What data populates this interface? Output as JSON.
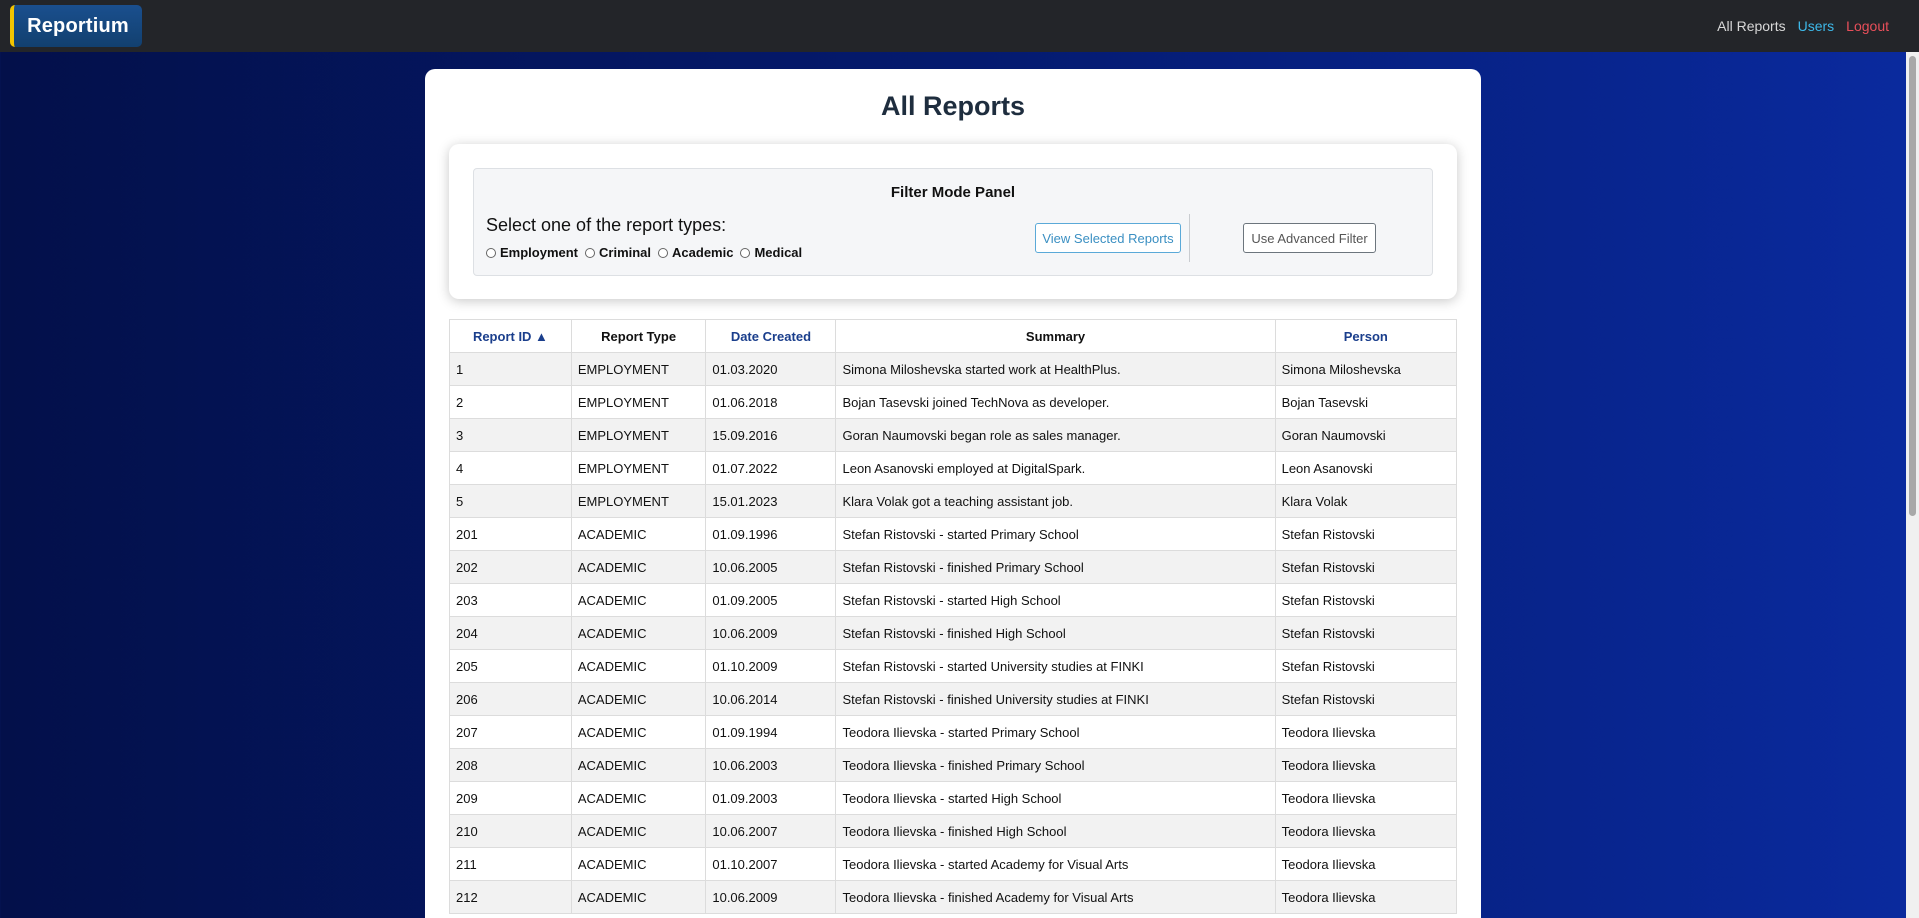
{
  "nav": {
    "brand": "Reportium",
    "links": {
      "all_reports": "All Reports",
      "users": "Users",
      "logout": "Logout"
    }
  },
  "page": {
    "title": "All Reports"
  },
  "filter": {
    "title": "Filter Mode Panel",
    "question": "Select one of the report types:",
    "options": [
      "Employment",
      "Criminal",
      "Academic",
      "Medical"
    ],
    "view_button": "View Selected Reports",
    "advanced_button": "Use Advanced Filter"
  },
  "table": {
    "headers": {
      "id": "Report ID ▲",
      "type": "Report Type",
      "date": "Date Created",
      "summary": "Summary",
      "person": "Person"
    },
    "rows": [
      {
        "id": "1",
        "type": "EMPLOYMENT",
        "date": "01.03.2020",
        "summary": "Simona Miloshevska started work at HealthPlus.",
        "person": "Simona Miloshevska"
      },
      {
        "id": "2",
        "type": "EMPLOYMENT",
        "date": "01.06.2018",
        "summary": "Bojan Tasevski joined TechNova as developer.",
        "person": "Bojan Tasevski"
      },
      {
        "id": "3",
        "type": "EMPLOYMENT",
        "date": "15.09.2016",
        "summary": "Goran Naumovski began role as sales manager.",
        "person": "Goran Naumovski"
      },
      {
        "id": "4",
        "type": "EMPLOYMENT",
        "date": "01.07.2022",
        "summary": "Leon Asanovski employed at DigitalSpark.",
        "person": "Leon Asanovski"
      },
      {
        "id": "5",
        "type": "EMPLOYMENT",
        "date": "15.01.2023",
        "summary": "Klara Volak got a teaching assistant job.",
        "person": "Klara Volak"
      },
      {
        "id": "201",
        "type": "ACADEMIC",
        "date": "01.09.1996",
        "summary": "Stefan Ristovski - started Primary School",
        "person": "Stefan Ristovski"
      },
      {
        "id": "202",
        "type": "ACADEMIC",
        "date": "10.06.2005",
        "summary": "Stefan Ristovski - finished Primary School",
        "person": "Stefan Ristovski"
      },
      {
        "id": "203",
        "type": "ACADEMIC",
        "date": "01.09.2005",
        "summary": "Stefan Ristovski - started High School",
        "person": "Stefan Ristovski"
      },
      {
        "id": "204",
        "type": "ACADEMIC",
        "date": "10.06.2009",
        "summary": "Stefan Ristovski - finished High School",
        "person": "Stefan Ristovski"
      },
      {
        "id": "205",
        "type": "ACADEMIC",
        "date": "01.10.2009",
        "summary": "Stefan Ristovski - started University studies at FINKI",
        "person": "Stefan Ristovski"
      },
      {
        "id": "206",
        "type": "ACADEMIC",
        "date": "10.06.2014",
        "summary": "Stefan Ristovski - finished University studies at FINKI",
        "person": "Stefan Ristovski"
      },
      {
        "id": "207",
        "type": "ACADEMIC",
        "date": "01.09.1994",
        "summary": "Teodora Ilievska - started Primary School",
        "person": "Teodora Ilievska"
      },
      {
        "id": "208",
        "type": "ACADEMIC",
        "date": "10.06.2003",
        "summary": "Teodora Ilievska - finished Primary School",
        "person": "Teodora Ilievska"
      },
      {
        "id": "209",
        "type": "ACADEMIC",
        "date": "01.09.2003",
        "summary": "Teodora Ilievska - started High School",
        "person": "Teodora Ilievska"
      },
      {
        "id": "210",
        "type": "ACADEMIC",
        "date": "10.06.2007",
        "summary": "Teodora Ilievska - finished High School",
        "person": "Teodora Ilievska"
      },
      {
        "id": "211",
        "type": "ACADEMIC",
        "date": "01.10.2007",
        "summary": "Teodora Ilievska - started Academy for Visual Arts",
        "person": "Teodora Ilievska"
      },
      {
        "id": "212",
        "type": "ACADEMIC",
        "date": "10.06.2009",
        "summary": "Teodora Ilievska - finished Academy for Visual Arts",
        "person": "Teodora Ilievska"
      }
    ]
  },
  "colors": {
    "navbar_bg": "#232529",
    "brand_accent": "#f2c400",
    "users_link": "#3db8e8",
    "logout_link": "#e84f5a",
    "sortable_header": "#1a3e8c"
  }
}
